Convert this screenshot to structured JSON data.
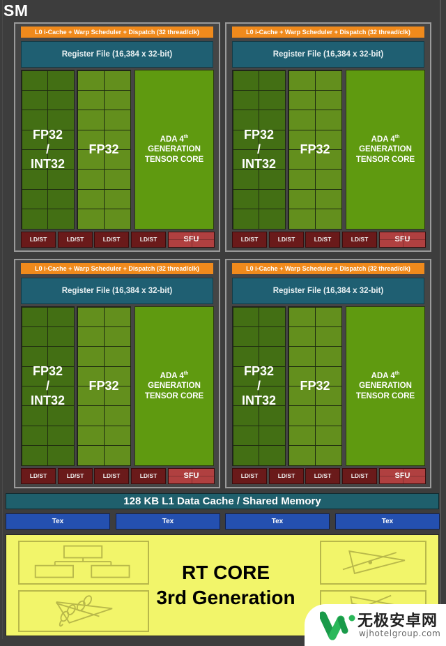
{
  "title": "SM",
  "sub_partitions": [
    {
      "id": "top-left",
      "l0_cache": "L0 i-Cache + Warp Scheduler + Dispatch (32 thread/clk)",
      "register_file": "Register File (16,384 x 32-bit)",
      "int_column": {
        "line1": "FP32",
        "line2": "/",
        "line3": "INT32"
      },
      "fp_column": "FP32",
      "tensor": {
        "line1": "ADA 4",
        "sup": "th",
        "line2": "GENERATION",
        "line3": "TENSOR CORE"
      },
      "ldst": [
        "LD/ST",
        "LD/ST",
        "LD/ST",
        "LD/ST"
      ],
      "sfu": "SFU"
    },
    {
      "id": "top-right",
      "l0_cache": "L0 i-Cache + Warp Scheduler + Dispatch (32 thread/clk)",
      "register_file": "Register File (16,384 x 32-bit)",
      "int_column": {
        "line1": "FP32",
        "line2": "/",
        "line3": "INT32"
      },
      "fp_column": "FP32",
      "tensor": {
        "line1": "ADA 4",
        "sup": "th",
        "line2": "GENERATION",
        "line3": "TENSOR CORE"
      },
      "ldst": [
        "LD/ST",
        "LD/ST",
        "LD/ST",
        "LD/ST"
      ],
      "sfu": "SFU"
    },
    {
      "id": "bottom-left",
      "l0_cache": "L0 i-Cache + Warp Scheduler + Dispatch (32 thread/clk)",
      "register_file": "Register File (16,384 x 32-bit)",
      "int_column": {
        "line1": "FP32",
        "line2": "/",
        "line3": "INT32"
      },
      "fp_column": "FP32",
      "tensor": {
        "line1": "ADA 4",
        "sup": "th",
        "line2": "GENERATION",
        "line3": "TENSOR CORE"
      },
      "ldst": [
        "LD/ST",
        "LD/ST",
        "LD/ST",
        "LD/ST"
      ],
      "sfu": "SFU"
    },
    {
      "id": "bottom-right",
      "l0_cache": "L0 i-Cache + Warp Scheduler + Dispatch (32 thread/clk)",
      "register_file": "Register File (16,384 x 32-bit)",
      "int_column": {
        "line1": "FP32",
        "line2": "/",
        "line3": "INT32"
      },
      "fp_column": "FP32",
      "tensor": {
        "line1": "ADA 4",
        "sup": "th",
        "line2": "GENERATION",
        "line3": "TENSOR CORE"
      },
      "ldst": [
        "LD/ST",
        "LD/ST",
        "LD/ST",
        "LD/ST"
      ],
      "sfu": "SFU"
    }
  ],
  "l1_cache": "128 KB L1 Data Cache / Shared Memory",
  "tex_units": [
    "Tex",
    "Tex",
    "Tex",
    "Tex"
  ],
  "rt_core": {
    "line1": "RT CORE",
    "line2": "3rd Generation"
  },
  "watermark": {
    "name": "无极安卓网",
    "url": "wjhotelgroup.com"
  },
  "colors": {
    "background": "#3d3d3d",
    "l0_cache": "#f08a1c",
    "register_file": "#1f5f72",
    "int_column": "#436f14",
    "fp_column": "#638f1d",
    "tensor_core": "#5f9a10",
    "ldst": "#6a1a1a",
    "sfu": "#b04040",
    "l1_cache": "#1f5f6c",
    "tex": "#2450b0",
    "rt_core": "#f2f56a"
  }
}
